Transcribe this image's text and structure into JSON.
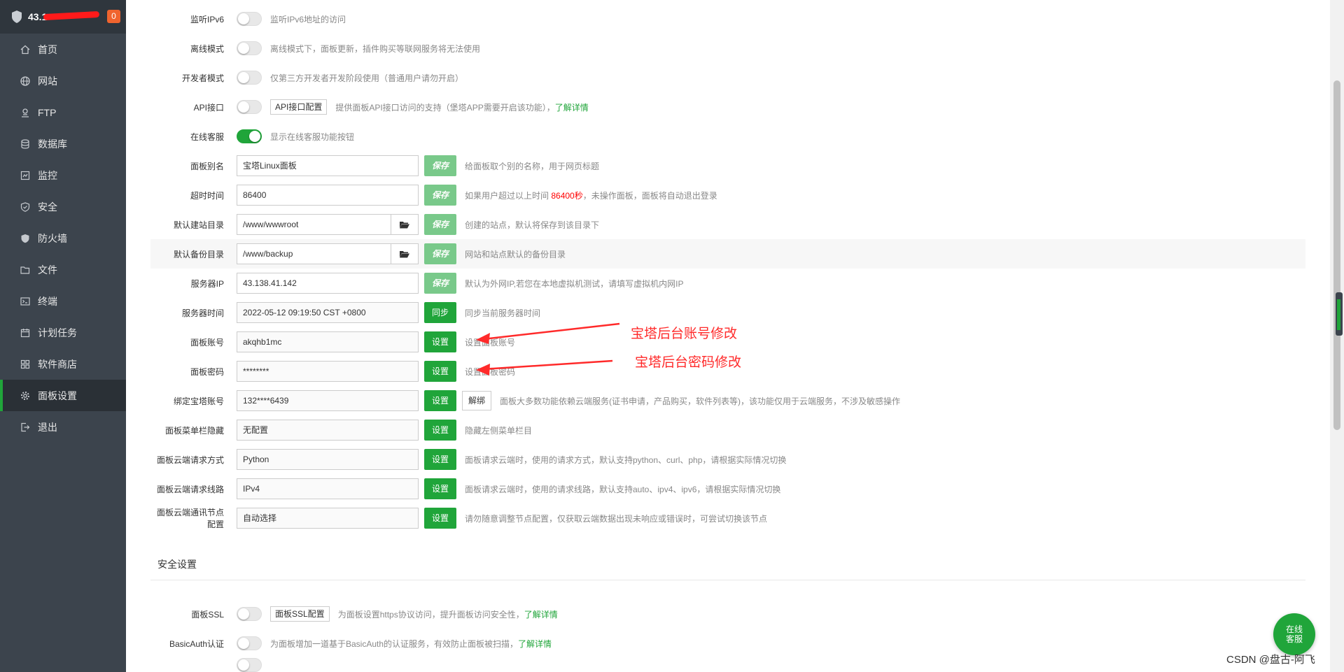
{
  "sidebar": {
    "ip": "43.1",
    "badge": "0",
    "items": [
      {
        "label": "首页",
        "icon": "home-icon"
      },
      {
        "label": "网站",
        "icon": "globe-icon"
      },
      {
        "label": "FTP",
        "icon": "ftp-icon"
      },
      {
        "label": "数据库",
        "icon": "database-icon"
      },
      {
        "label": "监控",
        "icon": "monitor-icon"
      },
      {
        "label": "安全",
        "icon": "shield-check-icon"
      },
      {
        "label": "防火墙",
        "icon": "firewall-icon"
      },
      {
        "label": "文件",
        "icon": "folder-icon"
      },
      {
        "label": "终端",
        "icon": "terminal-icon"
      },
      {
        "label": "计划任务",
        "icon": "calendar-icon"
      },
      {
        "label": "软件商店",
        "icon": "apps-icon"
      },
      {
        "label": "面板设置",
        "icon": "gear-icon"
      },
      {
        "label": "退出",
        "icon": "logout-icon"
      }
    ],
    "active_index": 11
  },
  "settings": {
    "ipv6": {
      "label": "监听IPv6",
      "on": false,
      "desc": "监听IPv6地址的访问"
    },
    "offline": {
      "label": "离线模式",
      "on": false,
      "desc": "离线模式下，面板更新，插件购买等联网服务将无法使用"
    },
    "developer": {
      "label": "开发者模式",
      "on": false,
      "desc": "仅第三方开发者开发阶段使用（普通用户请勿开启）"
    },
    "api": {
      "label": "API接口",
      "on": false,
      "button": "API接口配置",
      "desc": "提供面板API接口访问的支持（堡塔APP需要开启该功能），",
      "link": "了解详情"
    },
    "online_service": {
      "label": "在线客服",
      "on": true,
      "desc": "显示在线客服功能按钮"
    },
    "alias": {
      "label": "面板别名",
      "value": "宝塔Linux面板",
      "button": "保存",
      "desc": "给面板取个别的名称，用于网页标题"
    },
    "timeout": {
      "label": "超时时间",
      "value": "86400",
      "button": "保存",
      "desc_pre": "如果用户超过以上时间 ",
      "desc_red": "86400秒",
      "desc_post": "，未操作面板，面板将自动退出登录"
    },
    "site_dir": {
      "label": "默认建站目录",
      "value": "/www/wwwroot",
      "button": "保存",
      "desc": "创建的站点，默认将保存到该目录下"
    },
    "backup_dir": {
      "label": "默认备份目录",
      "value": "/www/backup",
      "button": "保存",
      "desc": "网站和站点默认的备份目录"
    },
    "server_ip": {
      "label": "服务器IP",
      "value": "43.138.41.142",
      "button": "保存",
      "desc": "默认为外网IP,若您在本地虚拟机测试，请填写虚拟机内网IP"
    },
    "server_time": {
      "label": "服务器时间",
      "value": "2022-05-12 09:19:50 CST +0800",
      "button": "同步",
      "desc": "同步当前服务器时间"
    },
    "account": {
      "label": "面板账号",
      "value": "akqhb1mc",
      "button": "设置",
      "desc": "设置面板账号"
    },
    "password": {
      "label": "面板密码",
      "value": "********",
      "button": "设置",
      "desc": "设置面板密码"
    },
    "bt_account": {
      "label": "绑定宝塔账号",
      "value": "132****6439",
      "button": "设置",
      "unbind": "解绑",
      "desc": "面板大多数功能依赖云端服务(证书申请，产品购买，软件列表等)，该功能仅用于云端服务，不涉及敏感操作"
    },
    "menu_hide": {
      "label": "面板菜单栏隐藏",
      "value": "无配置",
      "button": "设置",
      "desc": "隐藏左侧菜单栏目"
    },
    "req_method": {
      "label": "面板云端请求方式",
      "value": "Python",
      "button": "设置",
      "desc": "面板请求云端时，使用的请求方式，默认支持python、curl、php，请根据实际情况切换"
    },
    "req_line": {
      "label": "面板云端请求线路",
      "value": "IPv4",
      "button": "设置",
      "desc": "面板请求云端时，使用的请求线路，默认支持auto、ipv4、ipv6，请根据实际情况切换"
    },
    "node": {
      "label": "面板云端通讯节点配置",
      "value": "自动选择",
      "button": "设置",
      "desc": "请勿随意调整节点配置，仅获取云端数据出现未响应或错误时，可尝试切换该节点"
    }
  },
  "security": {
    "title": "安全设置",
    "ssl": {
      "label": "面板SSL",
      "on": false,
      "button": "面板SSL配置",
      "desc": "为面板设置https协议访问，提升面板访问安全性，",
      "link": "了解详情"
    },
    "basic_auth": {
      "label": "BasicAuth认证",
      "on": false,
      "desc": "为面板增加一道基于BasicAuth的认证服务，有效防止面板被扫描，",
      "link": "了解详情"
    }
  },
  "annotations": {
    "account_note": "宝塔后台账号修改",
    "password_note": "宝塔后台密码修改"
  },
  "chat": {
    "label_line1": "在线",
    "label_line2": "客服"
  },
  "watermark": "CSDN @盘古-阿飞",
  "colors": {
    "accent": "#20a53a",
    "sidebar": "#3c444d",
    "annotation": "#ff2a2a"
  }
}
